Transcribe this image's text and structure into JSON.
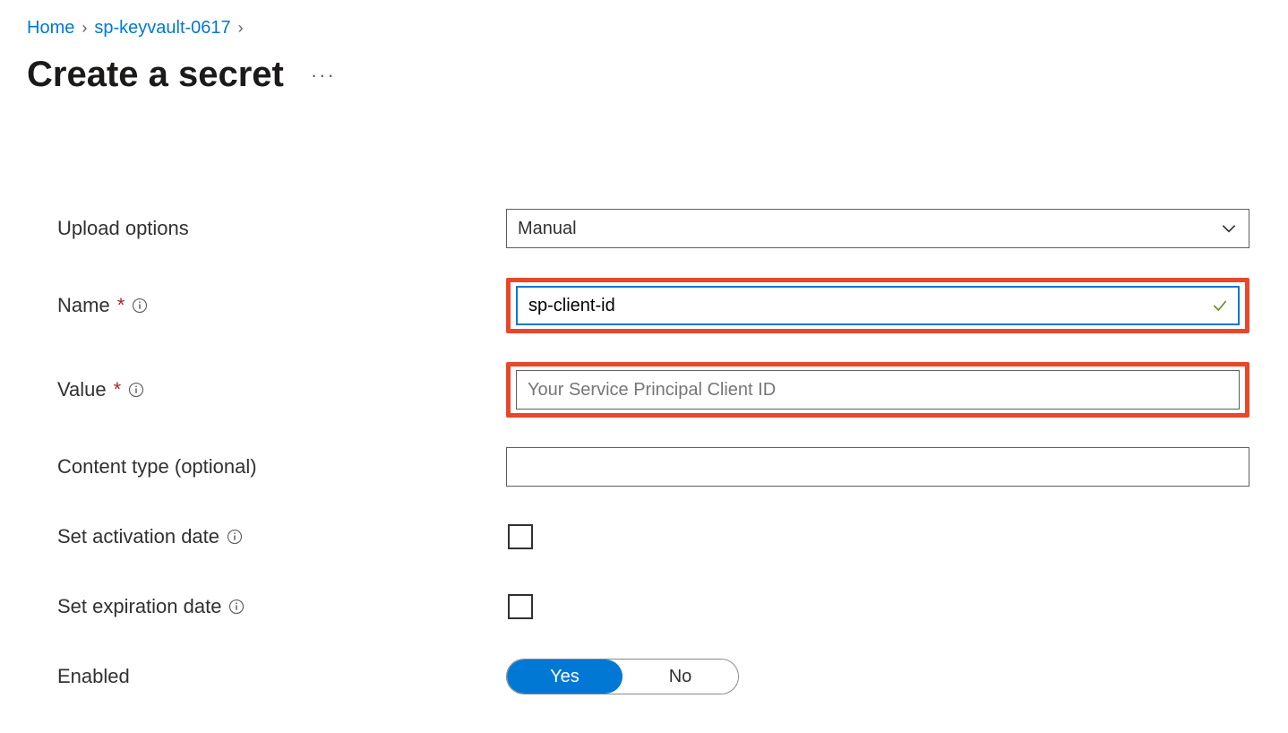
{
  "breadcrumb": {
    "home": "Home",
    "resource": "sp-keyvault-0617"
  },
  "title": "Create a secret",
  "form": {
    "upload_options": {
      "label": "Upload options",
      "value": "Manual"
    },
    "name": {
      "label": "Name",
      "value": "sp-client-id"
    },
    "value_field": {
      "label": "Value",
      "placeholder": "Your Service Principal Client ID"
    },
    "content_type": {
      "label": "Content type (optional)",
      "value": ""
    },
    "activation": {
      "label": "Set activation date"
    },
    "expiration": {
      "label": "Set expiration date"
    },
    "enabled": {
      "label": "Enabled",
      "yes": "Yes",
      "no": "No"
    }
  }
}
